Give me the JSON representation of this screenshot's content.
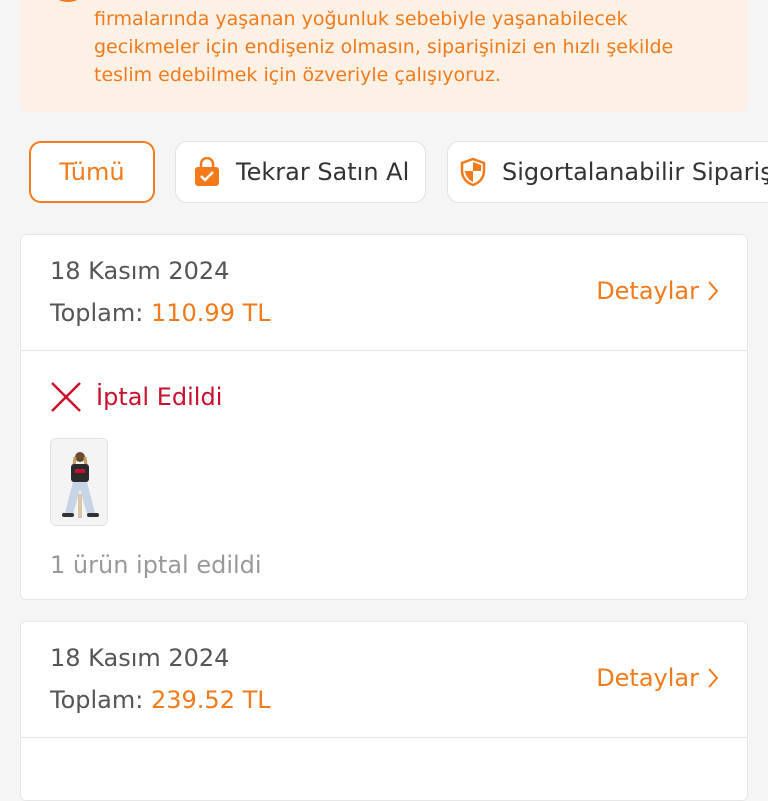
{
  "notice": {
    "lines": [
      "firmalarında yaşanan yoğunluk sebebiyle yaşanabilecek",
      "gecikmeler için endişeniz olmasın, siparişinizi en hızlı şekilde",
      "teslim edebilmek için özveriyle çalışıyoruz."
    ]
  },
  "filters": {
    "all": "Tümü",
    "rebuy": "Tekrar Satın Al",
    "insurable": "Sigortalanabilir Siparişl"
  },
  "orders": [
    {
      "date": "18 Kasım 2024",
      "total_label": "Toplam:",
      "total_value": "110.99 TL",
      "details": "Detaylar",
      "status": "İptal Edildi",
      "note": "1 ürün iptal edildi"
    },
    {
      "date": "18 Kasım 2024",
      "total_label": "Toplam:",
      "total_value": "239.52 TL",
      "details": "Detaylar"
    }
  ],
  "colors": {
    "accent": "#f27a1a",
    "cancel": "#c8102e"
  },
  "icons": {
    "notice": "info-icon",
    "rebuy": "shopping-bag-icon",
    "insurable": "shield-icon",
    "status": "x-icon",
    "chevron": "chevron-right-icon"
  }
}
